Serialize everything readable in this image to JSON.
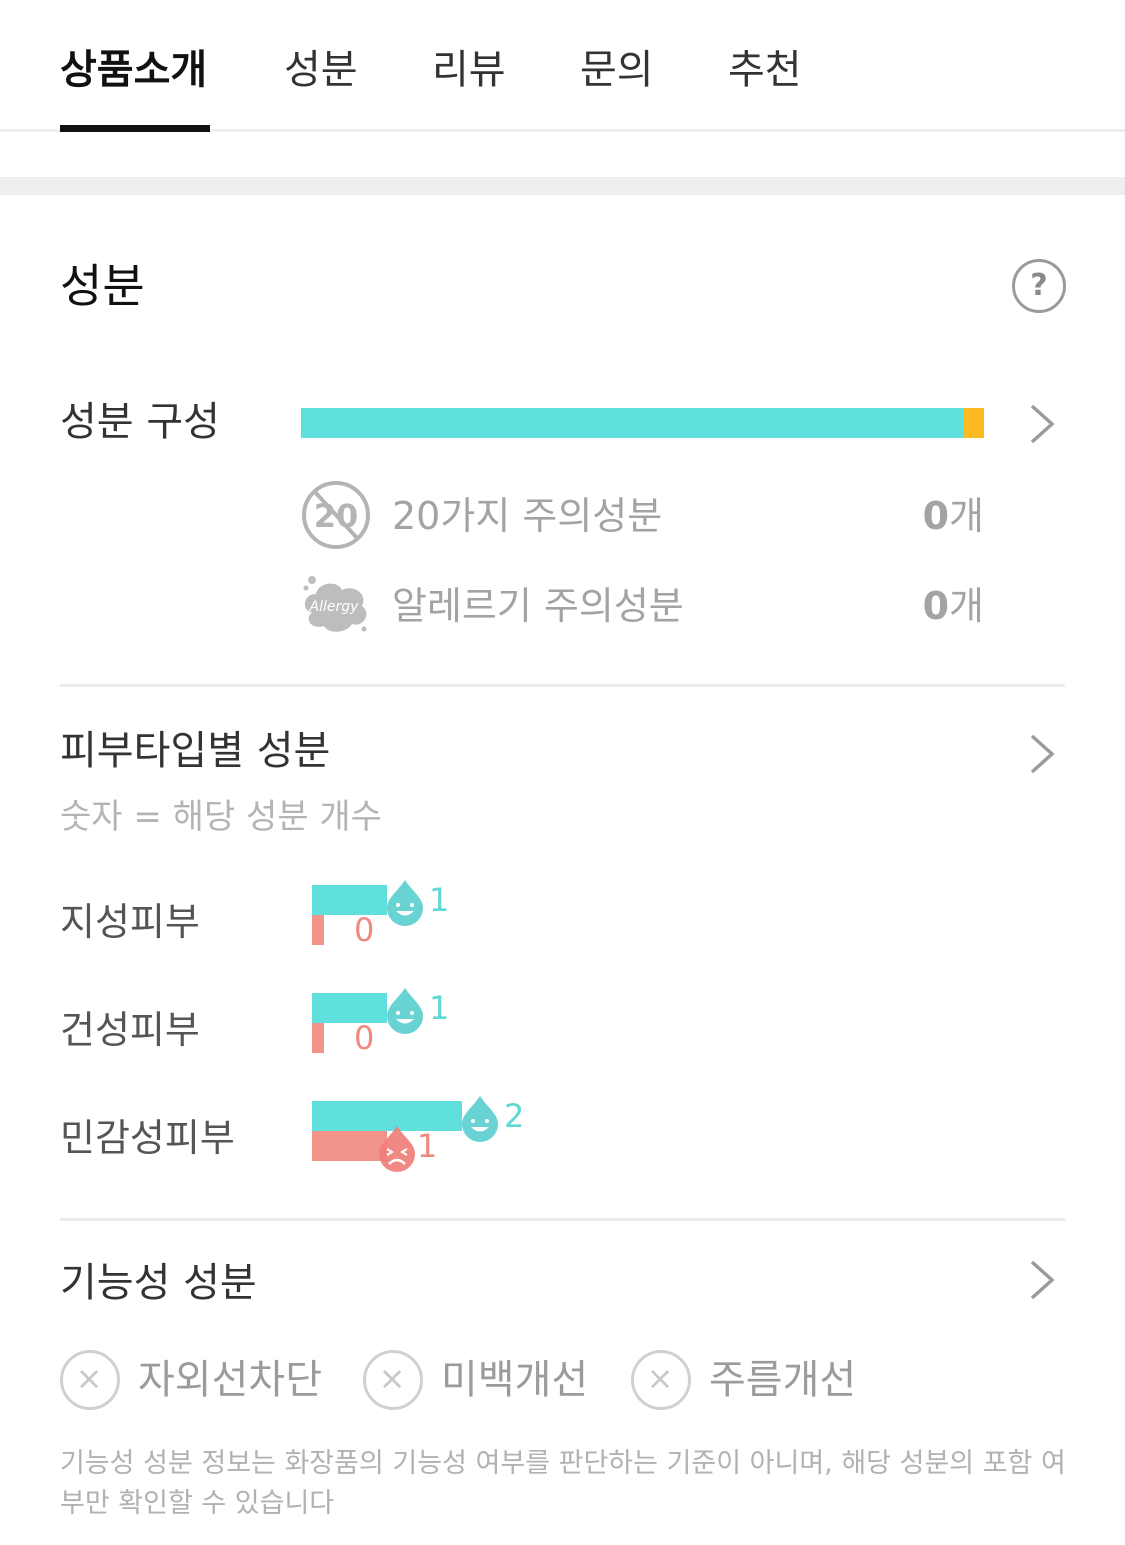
{
  "tabs": [
    {
      "label": "상품소개",
      "active": true
    },
    {
      "label": "성분",
      "active": false
    },
    {
      "label": "리뷰",
      "active": false
    },
    {
      "label": "문의",
      "active": false
    },
    {
      "label": "추천",
      "active": false
    }
  ],
  "section": {
    "title": "성분",
    "help_symbol": "?"
  },
  "composition": {
    "title": "성분 구성",
    "safe_fraction": 0.97,
    "warn_fraction": 0.03,
    "colors": {
      "safe": "#5fe0dc",
      "warn": "#fbb922"
    },
    "rows": [
      {
        "icon": "no-20-icon",
        "badge_text": "20",
        "label": "20가지 주의성분",
        "count": "0",
        "unit": "개"
      },
      {
        "icon": "allergy-cloud-icon",
        "badge_text": "Allergy",
        "label": "알레르기 주의성분",
        "count": "0",
        "unit": "개"
      }
    ]
  },
  "skin_type": {
    "title": "피부타입별 성분",
    "subtitle": "숫자 = 해당 성분 개수",
    "rows": [
      {
        "label": "지성피부",
        "good": 1,
        "bad": 0
      },
      {
        "label": "건성피부",
        "good": 1,
        "bad": 0
      },
      {
        "label": "민감성피부",
        "good": 2,
        "bad": 1
      }
    ],
    "colors": {
      "good": "#5fe0dc",
      "bad": "#f2938a"
    }
  },
  "functional": {
    "title": "기능성 성분",
    "items": [
      {
        "label": "자외선차단",
        "present": false
      },
      {
        "label": "미백개선",
        "present": false
      },
      {
        "label": "주름개선",
        "present": false
      }
    ],
    "note": "기능성 성분 정보는 화장품의 기능성 여부를 판단하는 기준이 아니며, 해당 성분의 포함 여부만 확인할 수 있습니다"
  }
}
